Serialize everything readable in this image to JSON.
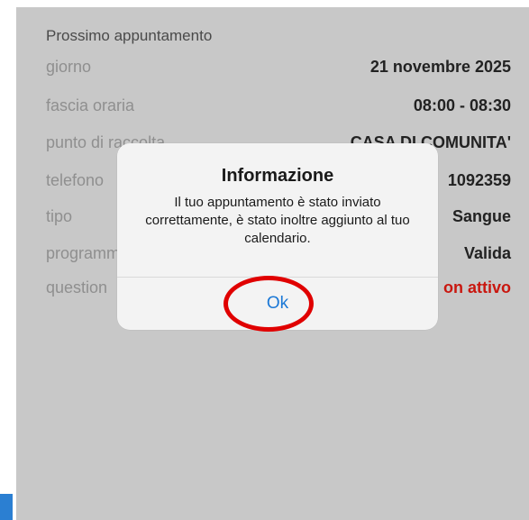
{
  "section": {
    "title": "Prossimo appuntamento"
  },
  "rows": [
    {
      "label": "giorno",
      "value": "21 novembre 2025"
    },
    {
      "label": "fascia oraria",
      "value": "08:00 - 08:30"
    },
    {
      "label": "punto di raccolta",
      "value": "CASA DI COMUNITA'"
    },
    {
      "label": "telefono",
      "value": "1092359"
    },
    {
      "label": "tipo",
      "value": "Sangue"
    },
    {
      "label": "programm",
      "value": "Valida"
    },
    {
      "label": "question",
      "value": "on attivo"
    }
  ],
  "dialog": {
    "title": "Informazione",
    "message": "Il tuo appuntamento è stato inviato correttamente, è stato inoltre aggiunto al tuo calendario.",
    "ok_label": "Ok"
  },
  "colors": {
    "accent": "#1b78d6",
    "alert": "#c9170f",
    "highlight": "#e00000",
    "overlay": "#c8c8c8"
  }
}
